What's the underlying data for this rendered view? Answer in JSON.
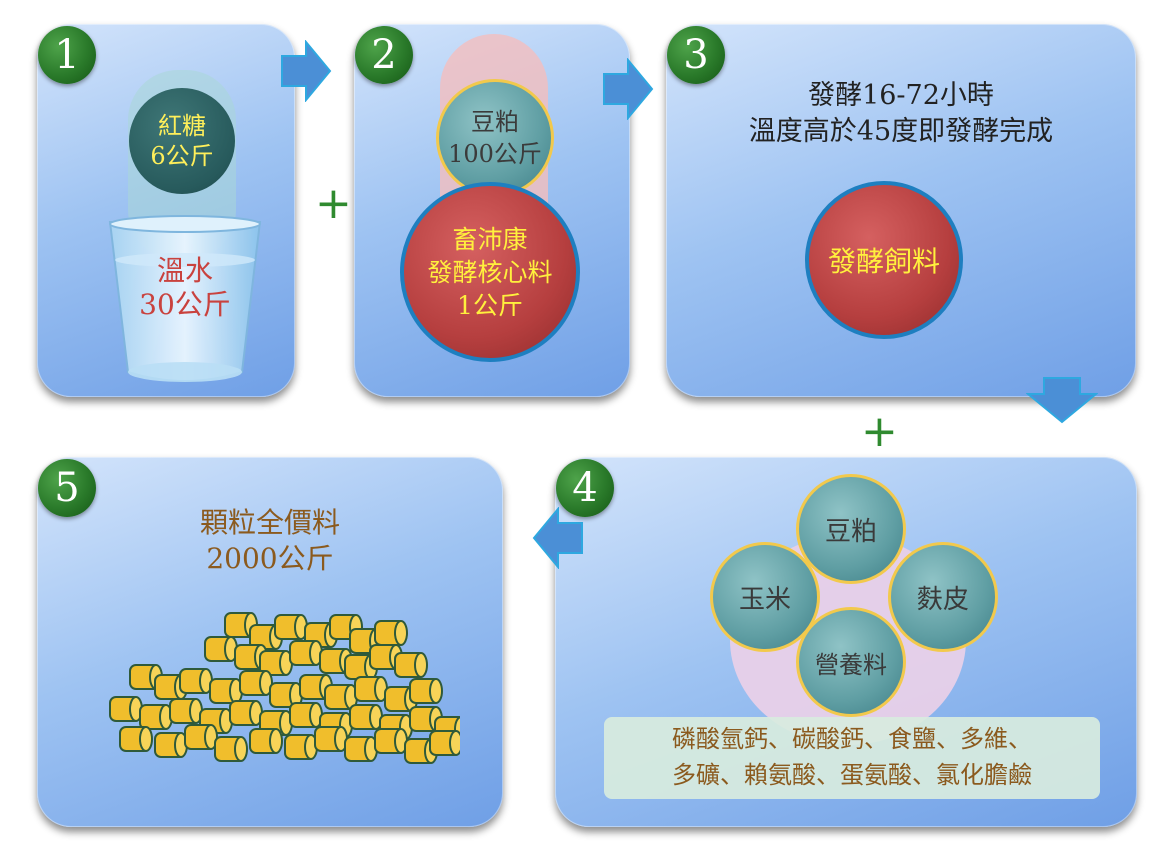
{
  "steps": [
    {
      "number": "1",
      "sugar": [
        "紅糖",
        "6公斤"
      ],
      "water": [
        "溫水",
        "30公斤"
      ]
    },
    {
      "number": "2",
      "soy": [
        "豆粕",
        "100公斤"
      ],
      "core": [
        "畜沛康",
        "發酵核心料",
        "1公斤"
      ]
    },
    {
      "number": "3",
      "description": [
        "發酵16-72小時",
        "溫度高於45度即發酵完成"
      ],
      "product": "發酵飼料"
    },
    {
      "number": "4",
      "ingredients": [
        "豆粕",
        "玉米",
        "麩皮",
        "營養料"
      ],
      "additives": [
        "磷酸氫鈣、碳酸鈣、食鹽、多維、",
        "多礦、賴氨酸、蛋氨酸、氯化膽鹼"
      ]
    },
    {
      "number": "5",
      "result": [
        "顆粒全價料",
        "2000公斤"
      ]
    }
  ],
  "plus_sign": "+",
  "colors": {
    "accent_green": "#2a7a2a",
    "arrow_blue": "#4a90d9",
    "highlight_yellow": "#f2c94c"
  }
}
